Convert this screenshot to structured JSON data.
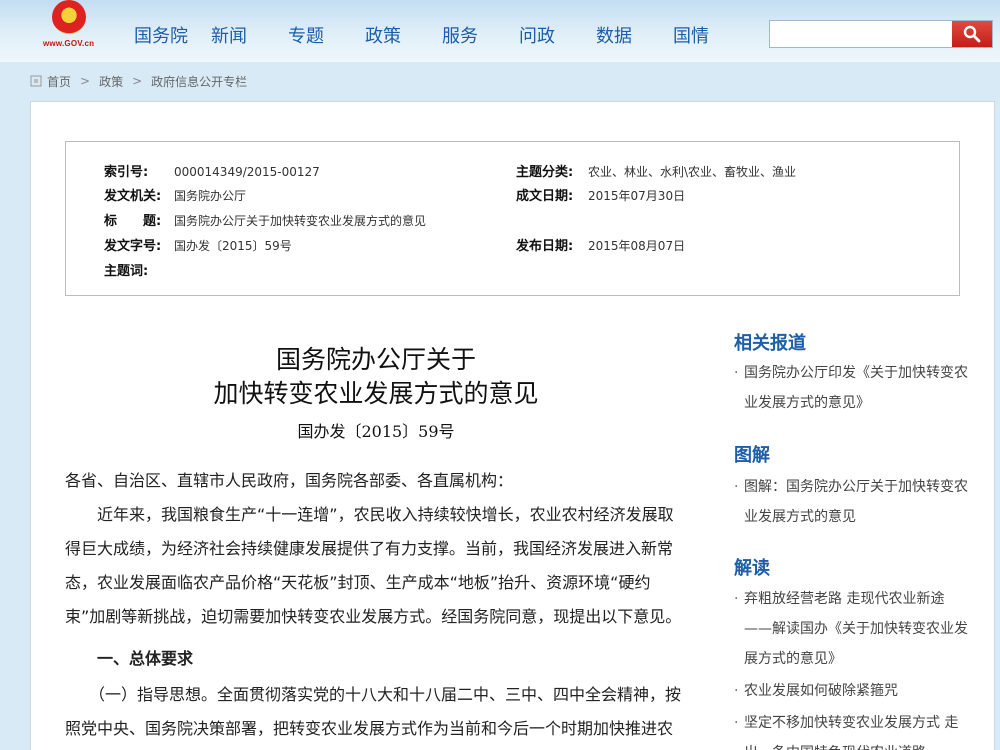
{
  "header": {
    "logo_text": "www.GOV.cn",
    "nav": [
      "国务院",
      "新闻",
      "专题",
      "政策",
      "服务",
      "问政",
      "数据",
      "国情"
    ],
    "search_placeholder": ""
  },
  "breadcrumb": [
    "首页",
    "政策",
    "政府信息公开专栏"
  ],
  "meta": {
    "index_label": "索引号:",
    "index_value": "000014349/2015-00127",
    "category_label": "主题分类:",
    "category_value": "农业、林业、水利\\农业、畜牧业、渔业",
    "issuer_label": "发文机关:",
    "issuer_value": "国务院办公厅",
    "written_label": "成文日期:",
    "written_value": "2015年07月30日",
    "title_label": "标　　题:",
    "title_value": "国务院办公厅关于加快转变农业发展方式的意见",
    "number_label": "发文字号:",
    "number_value": "国办发〔2015〕59号",
    "published_label": "发布日期:",
    "published_value": "2015年08月07日",
    "keywords_label": "主题词:",
    "keywords_value": ""
  },
  "document": {
    "title_line1": "国务院办公厅关于",
    "title_line2": "加快转变农业发展方式的意见",
    "number": "国办发〔2015〕59号",
    "salutation": "各省、自治区、直辖市人民政府，国务院各部委、各直属机构：",
    "para1": "　　近年来，我国粮食生产“十一连增”，农民收入持续较快增长，农业农村经济发展取得巨大成绩，为经济社会持续健康发展提供了有力支撑。当前，我国经济发展进入新常态，农业发展面临农产品价格“天花板”封顶、生产成本“地板”抬升、资源环境“硬约束”加剧等新挑战，迫切需要加快转变农业发展方式。经国务院同意，现提出以下意见。",
    "heading1": "　　一、总体要求",
    "para2": "　　（一）指导思想。全面贯彻落实党的十八大和十八届二中、三中、四中全会精神，按照党中央、国务院决策部署，把转变农业发展方式作为当前和今后一个时期加快推进农业现代化的根本途径"
  },
  "sidebar": {
    "related_heading": "相关报道",
    "related_links": [
      "国务院办公厅印发《关于加快转变农业发展方式的意见》"
    ],
    "graphic_heading": "图解",
    "graphic_links": [
      "图解：国务院办公厅关于加快转变农业发展方式的意见"
    ],
    "reading_heading": "解读",
    "reading_links": [
      "弃粗放经营老路 走现代农业新途——解读国办《关于加快转变农业发展方式的意见》",
      "农业发展如何破除紧箍咒",
      "坚定不移加快转变农业发展方式 走出一条中国特色现代农业道路"
    ]
  },
  "colors": {
    "nav": "#1c5ea8",
    "search_button": "#c21f17",
    "sidebar_heading": "#1c5ea8"
  }
}
